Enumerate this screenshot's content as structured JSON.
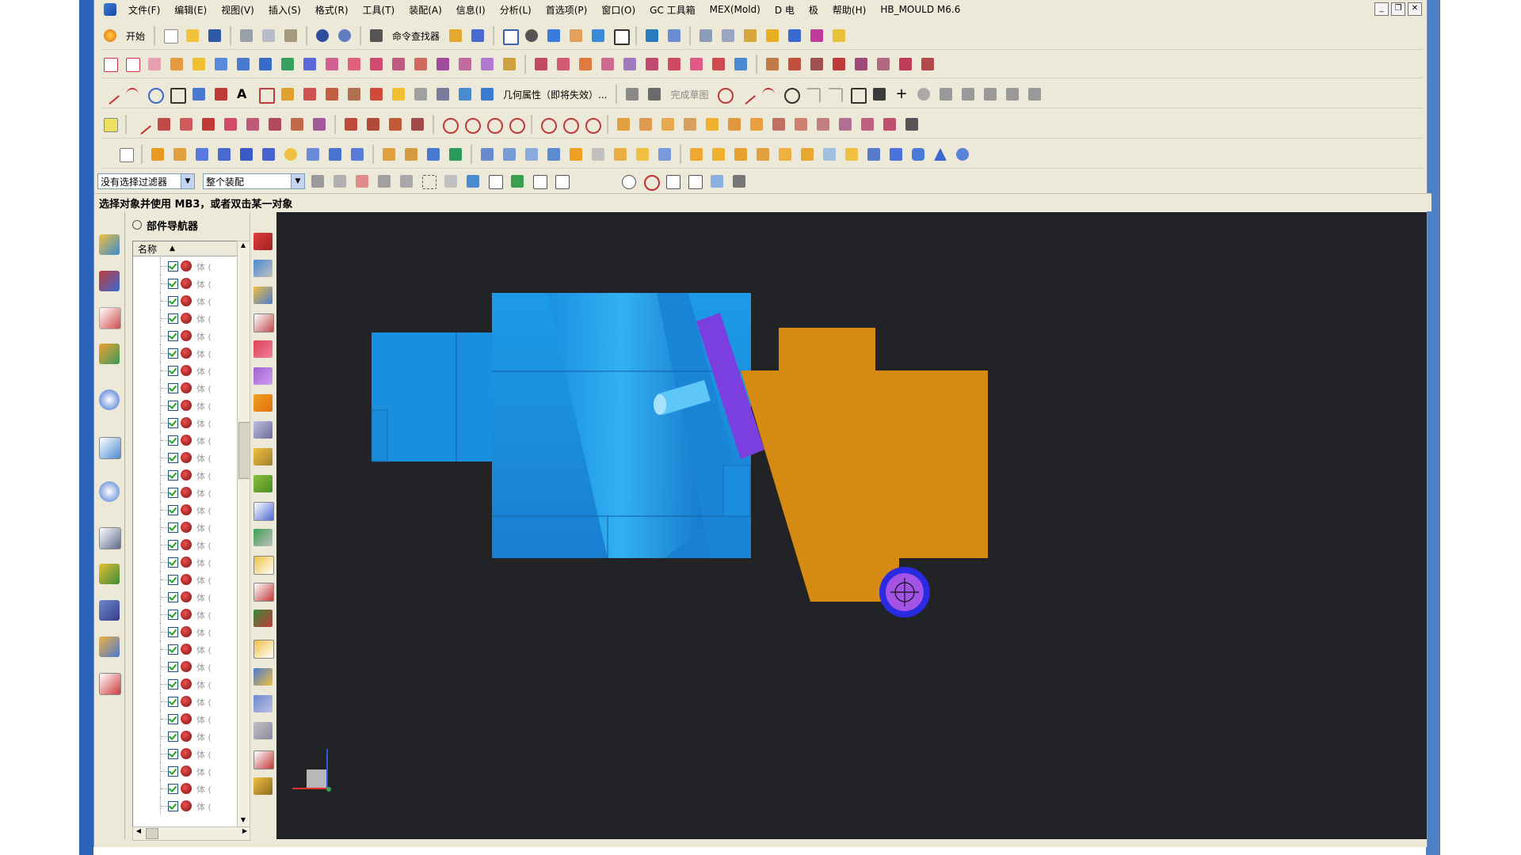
{
  "menu": {
    "items": [
      "文件(F)",
      "编辑(E)",
      "视图(V)",
      "插入(S)",
      "格式(R)",
      "工具(T)",
      "装配(A)",
      "信息(I)",
      "分析(L)",
      "首选项(P)",
      "窗口(O)",
      "GC 工具箱",
      "MEX(Mold)",
      "D 电",
      "极",
      "帮助(H)",
      "HB_MOULD M6.6"
    ],
    "win_min": "_",
    "win_restore": "❐",
    "win_close": "✕"
  },
  "toolbar": {
    "start_label": "开始",
    "command_finder_label": "命令查找器",
    "geom_props_label": "几何属性（即将失效）...",
    "finish_sketch_label": "完成草图"
  },
  "filterbar": {
    "filter_value": "没有选择过滤器",
    "scope_value": "整个装配"
  },
  "status": {
    "prompt": "选择对象并使用 MB3，或者双击某一对象"
  },
  "navigator": {
    "title": "部件导航器",
    "column_name": "名称",
    "row_label": "体 (",
    "row_count": 32
  },
  "colors": {
    "viewport_bg": "#222326",
    "part_blue": "#1a8fe0",
    "part_orange": "#d58a12",
    "part_purple": "#7b3fe0"
  }
}
